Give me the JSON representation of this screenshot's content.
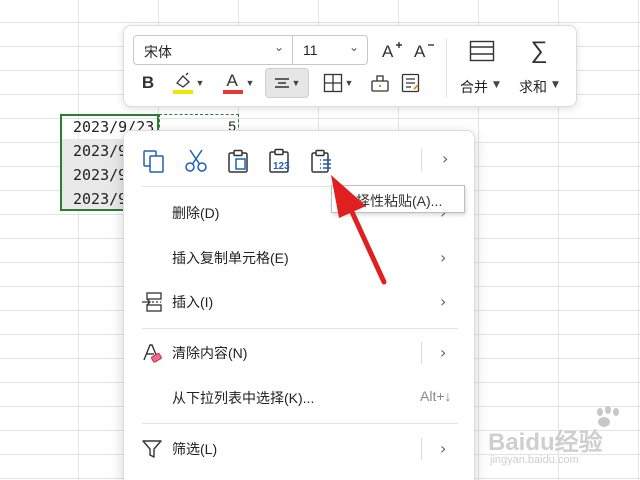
{
  "sheet": {
    "dates": [
      "2023/9/23",
      "2023/9/",
      "2023/9/",
      "2023/9/"
    ],
    "number_cell": "5"
  },
  "toolbar": {
    "font_name": "宋体",
    "font_size": "11",
    "bold_label": "B",
    "font_color_label": "A",
    "font_color": "#e53935",
    "fill_color": "#f2e600",
    "merge_label": "合并",
    "sum_label": "求和"
  },
  "menu": {
    "items": [
      {
        "label": "删除(D)"
      },
      {
        "label": "插入复制单元格(E)"
      },
      {
        "label": "插入(I)"
      },
      {
        "label": "清除内容(N)"
      },
      {
        "label": "从下拉列表中选择(K)...",
        "shortcut": "Alt+↓"
      },
      {
        "label": "筛选(L)"
      }
    ]
  },
  "tooltip": {
    "text": "选择性粘贴(A)..."
  },
  "watermark": {
    "brand": "Baidu经验",
    "url": "jingyan.baidu.com"
  },
  "colors": {
    "selection": "#2e7d32",
    "icon_blue": "#1e5fbf",
    "arrow": "#e02020"
  }
}
